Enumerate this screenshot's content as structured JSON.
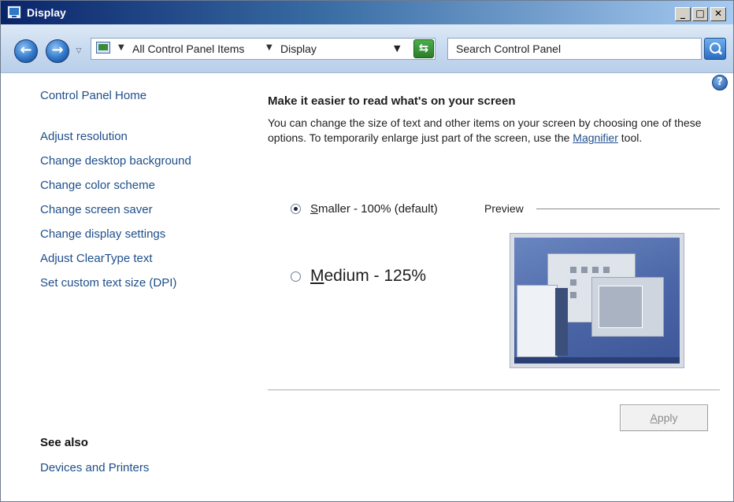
{
  "window": {
    "title": "Display",
    "min_glyph": "_",
    "max_glyph": "□",
    "close_glyph": "✕"
  },
  "nav": {
    "breadcrumb": [
      "All Control Panel Items",
      "Display"
    ],
    "search_placeholder": "Search Control Panel"
  },
  "sidebar": {
    "home": "Control Panel Home",
    "items": [
      "Adjust resolution",
      "Change desktop background",
      "Change color scheme",
      "Change screen saver",
      "Change display settings",
      "Adjust ClearType text",
      "Set custom text size (DPI)"
    ],
    "see_also_title": "See also",
    "see_also_items": [
      "Devices and Printers"
    ]
  },
  "main": {
    "heading": "Make it easier to read what's on your screen",
    "desc_before": "You can change the size of text and other items on your screen by choosing one of these options. To temporarily enlarge just part of the screen, use the ",
    "desc_link": "Magnifier",
    "desc_after": " tool.",
    "options": [
      {
        "mnemonic": "S",
        "rest": "maller - 100% (default)",
        "selected": true
      },
      {
        "mnemonic": "M",
        "rest": "edium - 125%",
        "selected": false
      }
    ],
    "preview_label": "Preview",
    "apply_mnemonic": "A",
    "apply_rest": "pply",
    "apply_enabled": false
  },
  "colors": {
    "link": "#1e4e8a",
    "titlebar_start": "#0a246a",
    "titlebar_end": "#a6caf0"
  }
}
